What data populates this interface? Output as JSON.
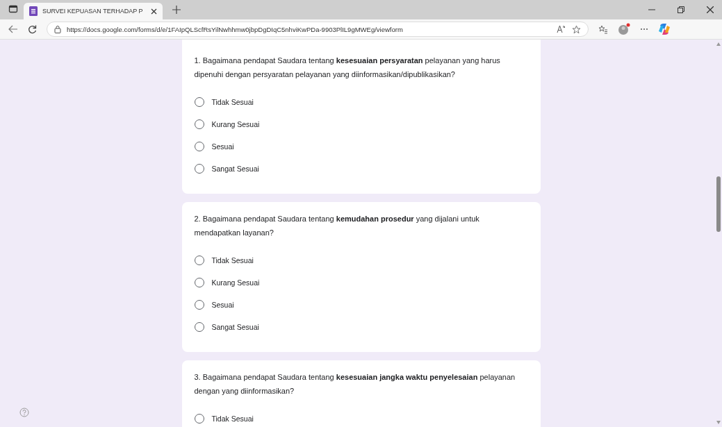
{
  "browser": {
    "tab": {
      "title": "SURVEI KEPUASAN TERHADAP P"
    },
    "url": "https://docs.google.com/forms/d/e/1FAIpQLScfRsYilNwhhmw0jbpDgDIqC5nhviKwPDa-9903PlIL9gMWEg/viewform"
  },
  "questions": [
    {
      "text": "1. Bagaimana pendapat Saudara tentang **kesesuaian persyaratan** pelayanan yang harus dipenuhi dengan persyaratan pelayanan yang diinformasikan/dipublikasikan?",
      "options": [
        {
          "label": "Tidak Sesuai",
          "selected": false
        },
        {
          "label": "Kurang Sesuai",
          "selected": false
        },
        {
          "label": "Sesuai",
          "selected": false
        },
        {
          "label": "Sangat Sesuai",
          "selected": false
        }
      ]
    },
    {
      "text": "2. Bagaimana pendapat Saudara tentang **kemudahan prosedur** yang dijalani untuk mendapatkan layanan?",
      "options": [
        {
          "label": "Tidak Sesuai",
          "selected": false
        },
        {
          "label": "Kurang Sesuai",
          "selected": false
        },
        {
          "label": "Sesuai",
          "selected": false
        },
        {
          "label": "Sangat Sesuai",
          "selected": false
        }
      ]
    },
    {
      "text": "3. Bagaimana pendapat Saudara tentang **kesesuaian jangka waktu penyelesaian** pelayanan dengan yang diinformasikan?",
      "options": [
        {
          "label": "Tidak Sesuai",
          "selected": false
        }
      ]
    }
  ]
}
